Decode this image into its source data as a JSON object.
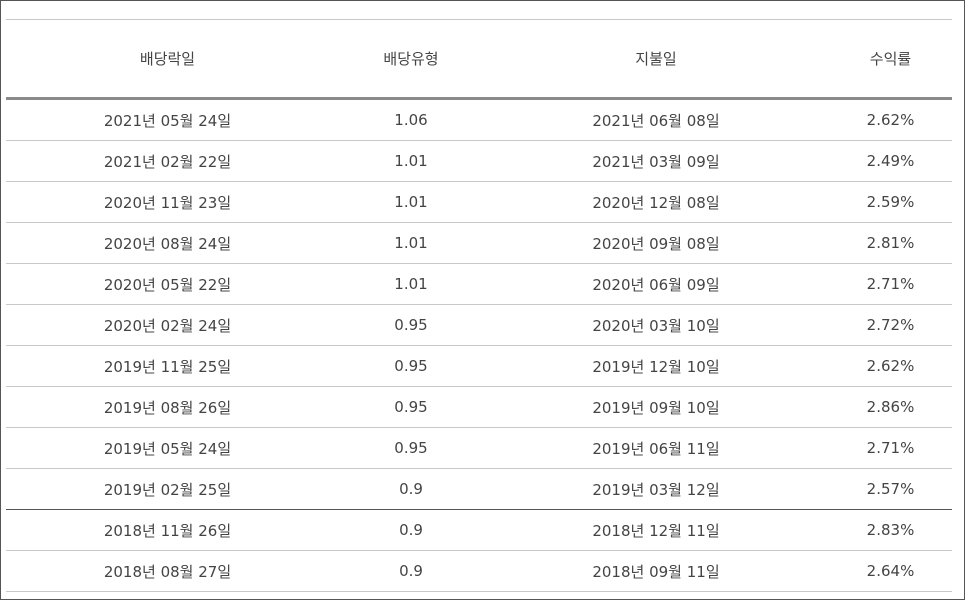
{
  "table": {
    "headers": [
      "배당락일",
      "배당유형",
      "지불일",
      "수익률"
    ],
    "rows": [
      {
        "ex_date": "2021년 05월 24일",
        "amount": "1.06",
        "pay_date": "2021년 06월 08일",
        "yield": "2.62%"
      },
      {
        "ex_date": "2021년 02월 22일",
        "amount": "1.01",
        "pay_date": "2021년 03월 09일",
        "yield": "2.49%"
      },
      {
        "ex_date": "2020년 11월 23일",
        "amount": "1.01",
        "pay_date": "2020년 12월 08일",
        "yield": "2.59%"
      },
      {
        "ex_date": "2020년 08월 24일",
        "amount": "1.01",
        "pay_date": "2020년 09월 08일",
        "yield": "2.81%"
      },
      {
        "ex_date": "2020년 05월 22일",
        "amount": "1.01",
        "pay_date": "2020년 06월 09일",
        "yield": "2.71%"
      },
      {
        "ex_date": "2020년 02월 24일",
        "amount": "0.95",
        "pay_date": "2020년 03월 10일",
        "yield": "2.72%"
      },
      {
        "ex_date": "2019년 11월 25일",
        "amount": "0.95",
        "pay_date": "2019년 12월 10일",
        "yield": "2.62%"
      },
      {
        "ex_date": "2019년 08월 26일",
        "amount": "0.95",
        "pay_date": "2019년 09월 10일",
        "yield": "2.86%"
      },
      {
        "ex_date": "2019년 05월 24일",
        "amount": "0.95",
        "pay_date": "2019년 06월 11일",
        "yield": "2.71%"
      },
      {
        "ex_date": "2019년 02월 25일",
        "amount": "0.9",
        "pay_date": "2019년 03월 12일",
        "yield": "2.57%"
      },
      {
        "ex_date": "2018년 11월 26일",
        "amount": "0.9",
        "pay_date": "2018년 12월 11일",
        "yield": "2.83%"
      },
      {
        "ex_date": "2018년 08월 27일",
        "amount": "0.9",
        "pay_date": "2018년 09월 11일",
        "yield": "2.64%"
      }
    ]
  }
}
